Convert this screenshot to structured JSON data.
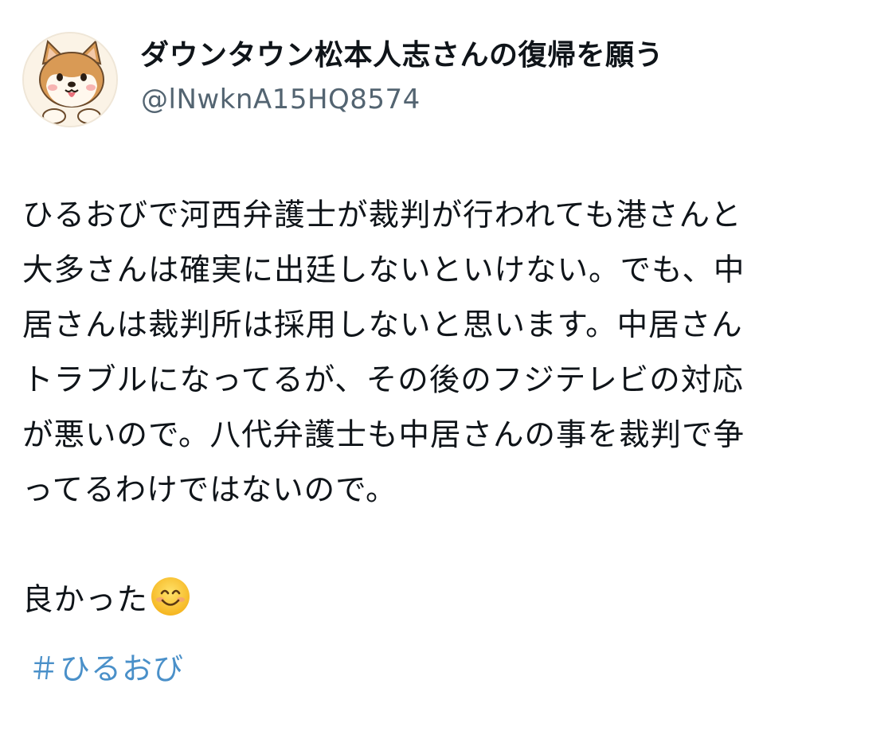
{
  "user": {
    "display_name": "ダウンタウン松本人志さんの復帰を願う",
    "handle": "@lNwknA15HQ8574",
    "avatar_icon": "shiba-dog-icon"
  },
  "tweet": {
    "lines": [
      "ひるおびで河西弁護士が裁判が行われても港さんと",
      "大多さんは確実に出廷しないといけない。でも、中",
      "居さんは裁判所は採用しないと思います。中居さん",
      "トラブルになってるが、その後のフジテレビの対応",
      "が悪いので。八代弁護士も中居さんの事を裁判で争",
      "ってるわけではないので。"
    ],
    "closing": "良かった",
    "emoji": "smiling-face-emoji",
    "hashtag": "＃ひるおび"
  },
  "colors": {
    "text": "#0f1419",
    "handle": "#536471",
    "hashtag": "#4a90c9"
  }
}
